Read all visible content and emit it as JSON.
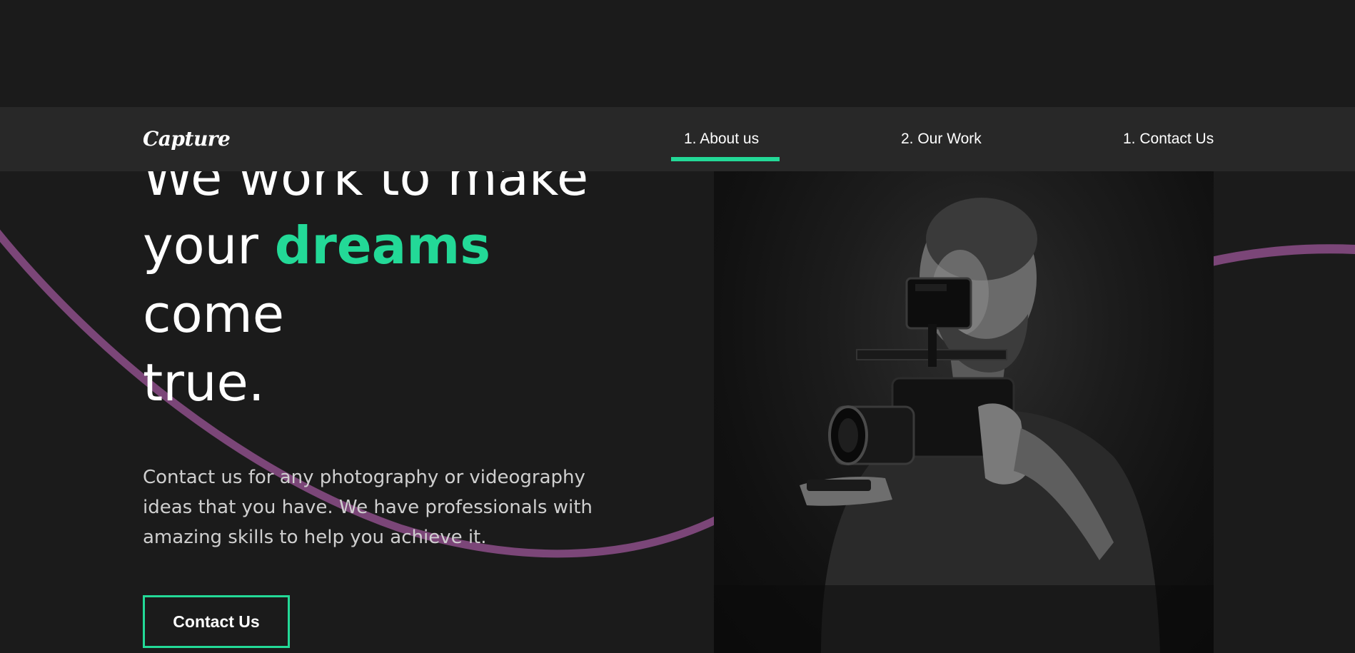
{
  "brand": {
    "logo_text": "Capture"
  },
  "nav": {
    "items": [
      {
        "label": "1. About us",
        "active": true
      },
      {
        "label": "2. Our Work",
        "active": false
      },
      {
        "label": "1. Contact Us",
        "active": false
      }
    ]
  },
  "hero": {
    "title_line1": "We work to make",
    "title_your": "your ",
    "title_highlight": "dreams",
    "title_line3": "come",
    "title_line4": "true.",
    "description": "Contact us for any photography or videography ideas that you have. We have professionals with amazing skills to help you achieve it.",
    "button_label": "Contact Us"
  },
  "theme": {
    "background": "#1b1b1b",
    "navbar_background": "#282828",
    "accent": "#23d997",
    "swoosh": "#7b4678"
  },
  "icons": {
    "hero_image": "videographer-photo"
  }
}
